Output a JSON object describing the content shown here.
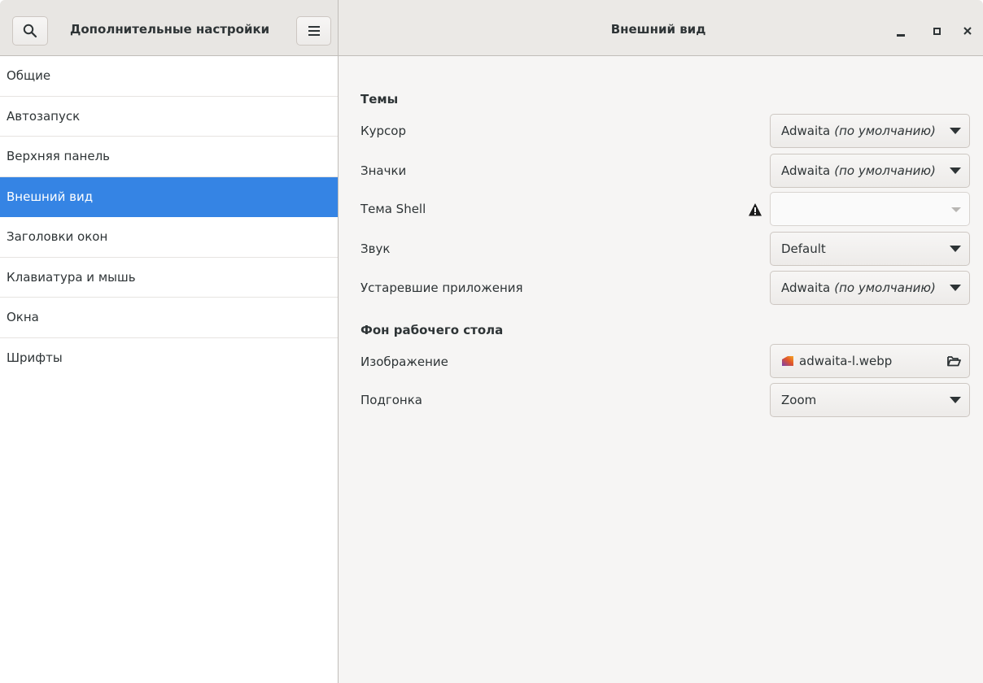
{
  "window": {
    "left_title": "Дополнительные настройки",
    "center_title": "Внешний вид"
  },
  "headerbar": {
    "search_icon": "search-icon",
    "menu_icon": "hamburger-menu-icon",
    "window_controls": [
      "minimize-icon",
      "maximize-icon",
      "close-icon"
    ]
  },
  "sidebar": {
    "selected_index": 3,
    "items": [
      {
        "label": "Общие"
      },
      {
        "label": "Автозапуск"
      },
      {
        "label": "Верхняя панель"
      },
      {
        "label": "Внешний вид"
      },
      {
        "label": "Заголовки окон"
      },
      {
        "label": "Клавиатура и мышь"
      },
      {
        "label": "Окна"
      },
      {
        "label": "Шрифты"
      }
    ]
  },
  "content": {
    "themes": {
      "title": "Темы",
      "cursor": {
        "label": "Курсор",
        "value": "Adwaita",
        "hint": "(по умолчанию)"
      },
      "icons": {
        "label": "Значки",
        "value": "Adwaita",
        "hint": "(по умолчанию)"
      },
      "shell": {
        "label": "Тема Shell",
        "value": "",
        "warning_icon": "warning-icon"
      },
      "sound": {
        "label": "Звук",
        "value": "Default"
      },
      "legacy": {
        "label": "Устаревшие приложения",
        "value": "Adwaita",
        "hint": "(по умолчанию)"
      }
    },
    "background": {
      "title": "Фон рабочего стола",
      "image": {
        "label": "Изображение",
        "file": "adwaita-l.webp",
        "file_icon": "image-file-icon",
        "open_icon": "folder-open-icon"
      },
      "adjustment": {
        "label": "Подгонка",
        "value": "Zoom"
      }
    }
  },
  "colors": {
    "accent": "#3584e4",
    "headerbar": "#ebe9e6",
    "sidebar_bg": "#ffffff",
    "content_bg": "#f6f5f4"
  }
}
